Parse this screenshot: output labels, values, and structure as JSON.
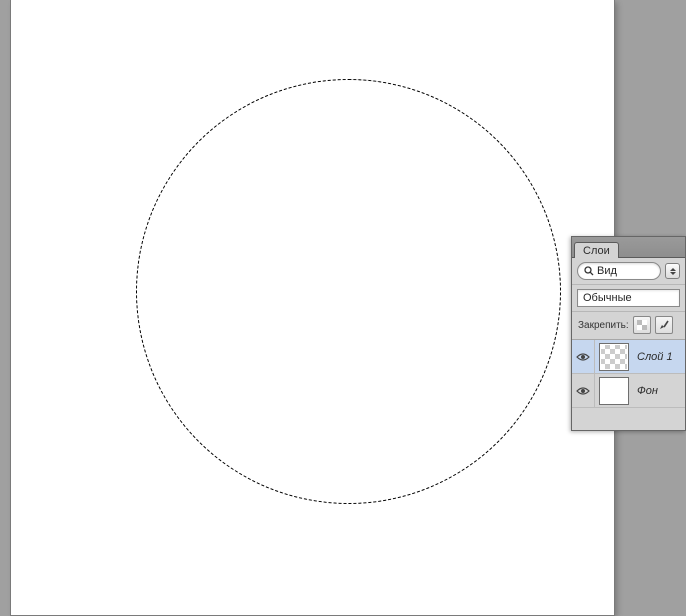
{
  "canvas": {
    "has_marquee_selection": true,
    "selection_shape": "ellipse"
  },
  "panel": {
    "tab_label": "Слои",
    "filter": {
      "label": "Вид"
    },
    "blend_mode": "Обычные",
    "lock": {
      "label": "Закрепить:"
    },
    "layers": [
      {
        "name": "Слой 1",
        "visible": true,
        "selected": true,
        "transparent": true
      },
      {
        "name": "Фон",
        "visible": true,
        "selected": false,
        "transparent": false
      }
    ]
  }
}
